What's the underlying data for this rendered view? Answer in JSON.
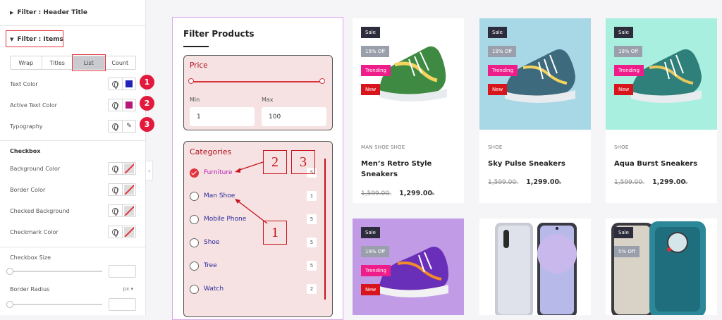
{
  "sidebar": {
    "header_title": "Filter : Header Title",
    "items_title": "Filter : Items",
    "tabs": [
      "Wrap",
      "Titles",
      "List",
      "Count"
    ],
    "active_tab": "List",
    "style_rows": [
      {
        "label": "Text Color",
        "badge": "1",
        "swatch": "#2323b8"
      },
      {
        "label": "Active Text Color",
        "badge": "2",
        "swatch": "#b8187a"
      },
      {
        "label": "Typography",
        "badge": "3"
      }
    ],
    "checkbox_title": "Checkbox",
    "checkbox_rows": [
      "Background Color",
      "Border Color",
      "Checked Background",
      "Checkmark Color"
    ],
    "size_label": "Checkbox Size",
    "radius_label": "Border Radius",
    "radius_unit": "px"
  },
  "filter": {
    "title": "Filter Products",
    "price_label": "Price",
    "min_label": "Min",
    "max_label": "Max",
    "min_value": "1",
    "max_value": "100",
    "categories_label": "Categories",
    "categories": [
      {
        "label": "Furniture",
        "count": "5",
        "checked": true
      },
      {
        "label": "Man Shoe",
        "count": "1",
        "checked": false
      },
      {
        "label": "Mobile Phone",
        "count": "5",
        "checked": false
      },
      {
        "label": "Shoe",
        "count": "5",
        "checked": false
      },
      {
        "label": "Tree",
        "count": "5",
        "checked": false
      },
      {
        "label": "Watch",
        "count": "2",
        "checked": false
      }
    ],
    "callouts": [
      "1",
      "2",
      "3"
    ]
  },
  "products": [
    {
      "categories": "MAN SHOE   SHOE",
      "name": "Men’s Retro Style Sneakers",
      "old_price": "1,599.00",
      "new_price": "1,299.00",
      "currency": "৳",
      "tags": [
        "Sale",
        "19% Off",
        "Trending",
        "New"
      ],
      "bg": "#ffffff",
      "image": "green-sneaker"
    },
    {
      "categories": "SHOE",
      "name": "Sky Pulse Sneakers",
      "old_price": "1,599.00",
      "new_price": "1,299.00",
      "currency": "৳",
      "tags": [
        "Sale",
        "19% Off",
        "Trending",
        "New"
      ],
      "bg": "#a8d8e6",
      "image": "blue-sneaker"
    },
    {
      "categories": "SHOE",
      "name": "Aqua Burst Sneakers",
      "old_price": "1,599.00",
      "new_price": "1,299.00",
      "currency": "৳",
      "tags": [
        "Sale",
        "19% Off",
        "Trending",
        "New"
      ],
      "bg": "#a8efe0",
      "image": "teal-sneaker"
    },
    {
      "tags": [
        "Sale",
        "19% Off",
        "Trending",
        "New"
      ],
      "bg": "#c29be6",
      "image": "purple-sneaker"
    },
    {
      "tags": [],
      "bg": "#ffffff",
      "image": "phone"
    },
    {
      "tags": [
        "Sale",
        "5% Off"
      ],
      "bg": "#ffffff",
      "image": "teal-phone"
    }
  ],
  "colors": {
    "accent": "#e2343c",
    "tag_dark": "#2c2c3c",
    "tag_grey": "#9aa0ab",
    "tag_pink": "#ee1d8a",
    "tag_red": "#d8151c"
  }
}
